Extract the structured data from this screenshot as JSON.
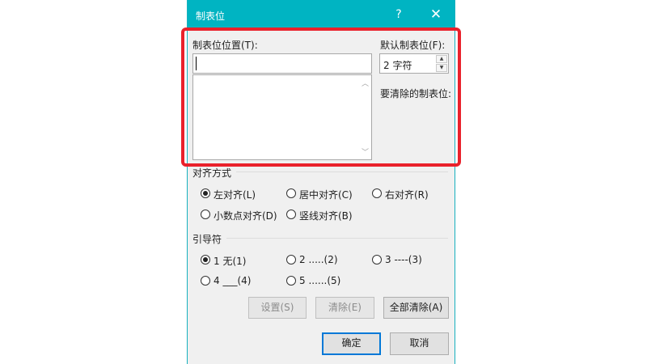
{
  "dialog": {
    "title": "制表位",
    "help_label": "?",
    "close_label": "✕",
    "icons": {
      "help": "help-icon",
      "close": "close-icon",
      "scroll_up": "scroll-up-icon",
      "scroll_down": "scroll-down-icon"
    }
  },
  "tab_stop": {
    "label": "制表位位置(T):",
    "value": "",
    "list_items": []
  },
  "default_tab": {
    "label": "默认制表位(F):",
    "value": "2 字符"
  },
  "to_clear": {
    "label": "要清除的制表位:"
  },
  "alignment": {
    "label": "对齐方式",
    "options": [
      {
        "label": "左对齐(L)",
        "checked": true
      },
      {
        "label": "居中对齐(C)",
        "checked": false
      },
      {
        "label": "右对齐(R)",
        "checked": false
      },
      {
        "label": "小数点对齐(D)",
        "checked": false
      },
      {
        "label": "竖线对齐(B)",
        "checked": false
      }
    ]
  },
  "leader": {
    "label": "引导符",
    "options": [
      {
        "label": "1 无(1)",
        "checked": true
      },
      {
        "label": "2 .....(2)",
        "checked": false
      },
      {
        "label": "3 ----(3)",
        "checked": false
      },
      {
        "label": "4 ___(4)",
        "checked": false
      },
      {
        "label": "5 ......(5)",
        "checked": false
      }
    ]
  },
  "buttons": {
    "set": "设置(S)",
    "clear": "清除(E)",
    "clear_all": "全部清除(A)",
    "ok": "确定",
    "cancel": "取消"
  },
  "colors": {
    "title_bar": "#00b4c2",
    "highlight": "#e9212b",
    "default_button_border": "#0078d7"
  }
}
